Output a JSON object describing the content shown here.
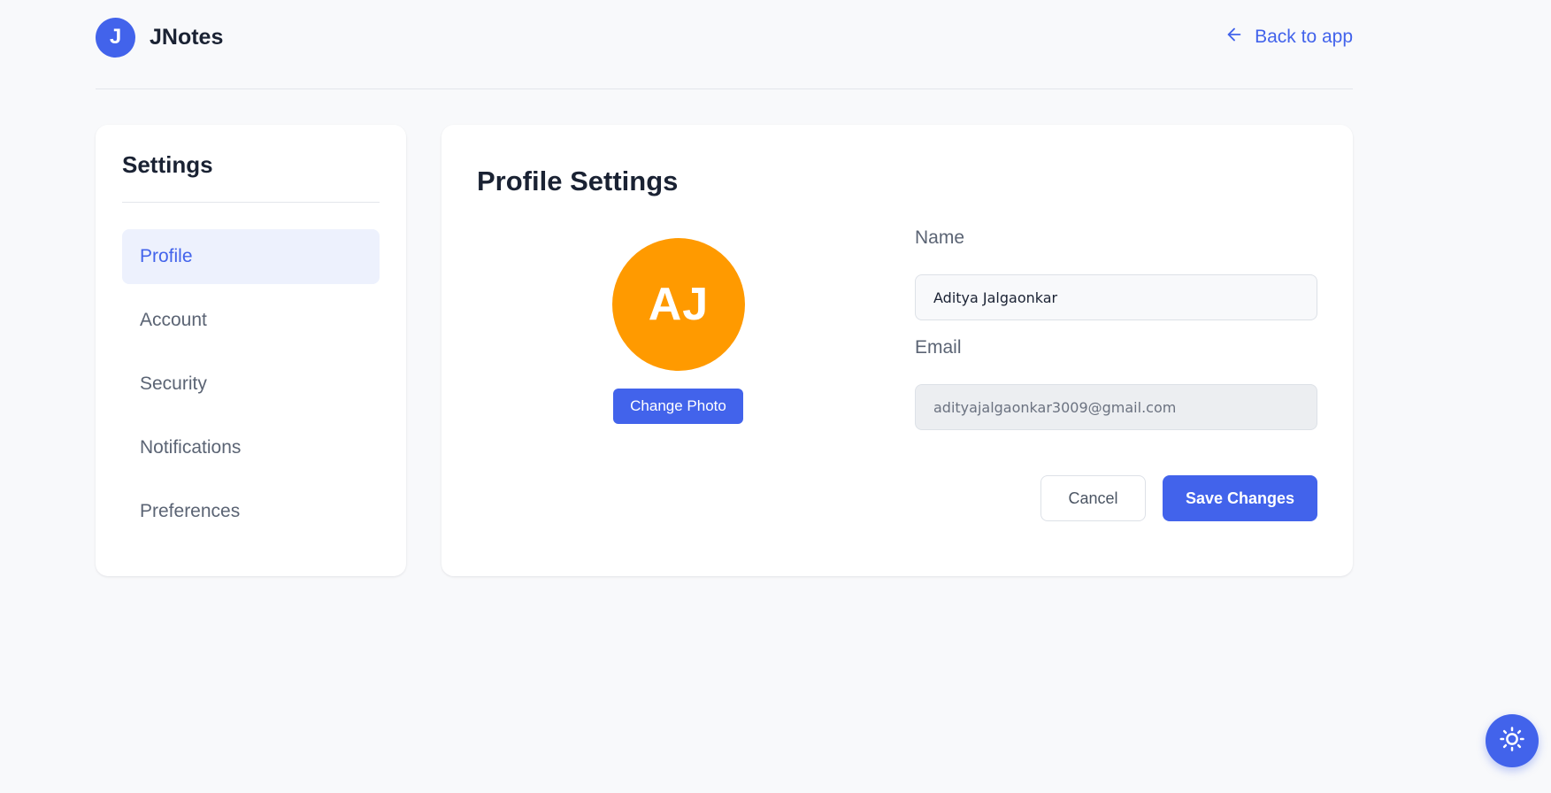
{
  "header": {
    "logo_letter": "J",
    "app_name": "JNotes",
    "back_label": "Back to app"
  },
  "sidebar": {
    "title": "Settings",
    "items": [
      {
        "label": "Profile",
        "active": true
      },
      {
        "label": "Account",
        "active": false
      },
      {
        "label": "Security",
        "active": false
      },
      {
        "label": "Notifications",
        "active": false
      },
      {
        "label": "Preferences",
        "active": false
      }
    ]
  },
  "profile": {
    "title": "Profile Settings",
    "avatar_initials": "AJ",
    "change_photo_label": "Change Photo",
    "name_label": "Name",
    "name_value": "Aditya Jalgaonkar",
    "email_label": "Email",
    "email_value": "adityajalgaonkar3009@gmail.com",
    "cancel_label": "Cancel",
    "save_label": "Save Changes"
  },
  "colors": {
    "accent": "#4263eb",
    "avatar": "#ff9a00",
    "background": "#f8f9fb"
  },
  "icons": {
    "back": "arrow-left-icon",
    "theme": "sun-icon"
  }
}
